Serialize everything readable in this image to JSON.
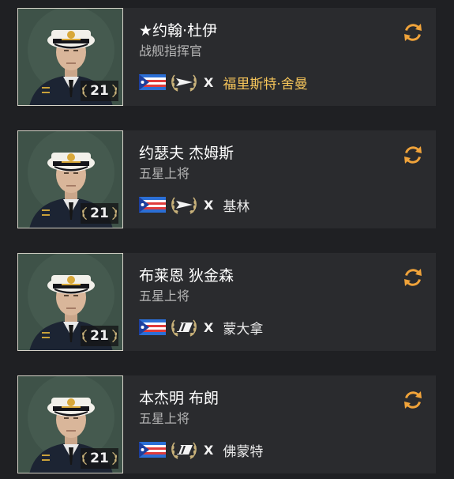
{
  "colors": {
    "background": "#1f2023",
    "card": "#2a2b2e",
    "accent_orange": "#f0a33a",
    "legendary_ship": "#f6c55a"
  },
  "commanders": [
    {
      "name": "★约翰·杜伊",
      "rank": "战舰指挥官",
      "level": "21",
      "tier": "X",
      "ship": "福里斯特·舍曼",
      "ship_highlight": true,
      "class_icon": "destroyer-icon",
      "flag_icon": "pan-america-flag-icon",
      "refresh_icon": "refresh-icon"
    },
    {
      "name": "约瑟夫  杰姆斯",
      "rank": "五星上将",
      "level": "21",
      "tier": "X",
      "ship": "基林",
      "ship_highlight": false,
      "class_icon": "destroyer-icon",
      "flag_icon": "pan-america-flag-icon",
      "refresh_icon": "refresh-icon"
    },
    {
      "name": "布莱恩  狄金森",
      "rank": "五星上将",
      "level": "21",
      "tier": "X",
      "ship": "蒙大拿",
      "ship_highlight": false,
      "class_icon": "battleship-icon",
      "flag_icon": "pan-america-flag-icon",
      "refresh_icon": "refresh-icon"
    },
    {
      "name": "本杰明  布朗",
      "rank": "五星上将",
      "level": "21",
      "tier": "X",
      "ship": "佛蒙特",
      "ship_highlight": false,
      "class_icon": "battleship-icon",
      "flag_icon": "pan-america-flag-icon",
      "refresh_icon": "refresh-icon"
    }
  ]
}
